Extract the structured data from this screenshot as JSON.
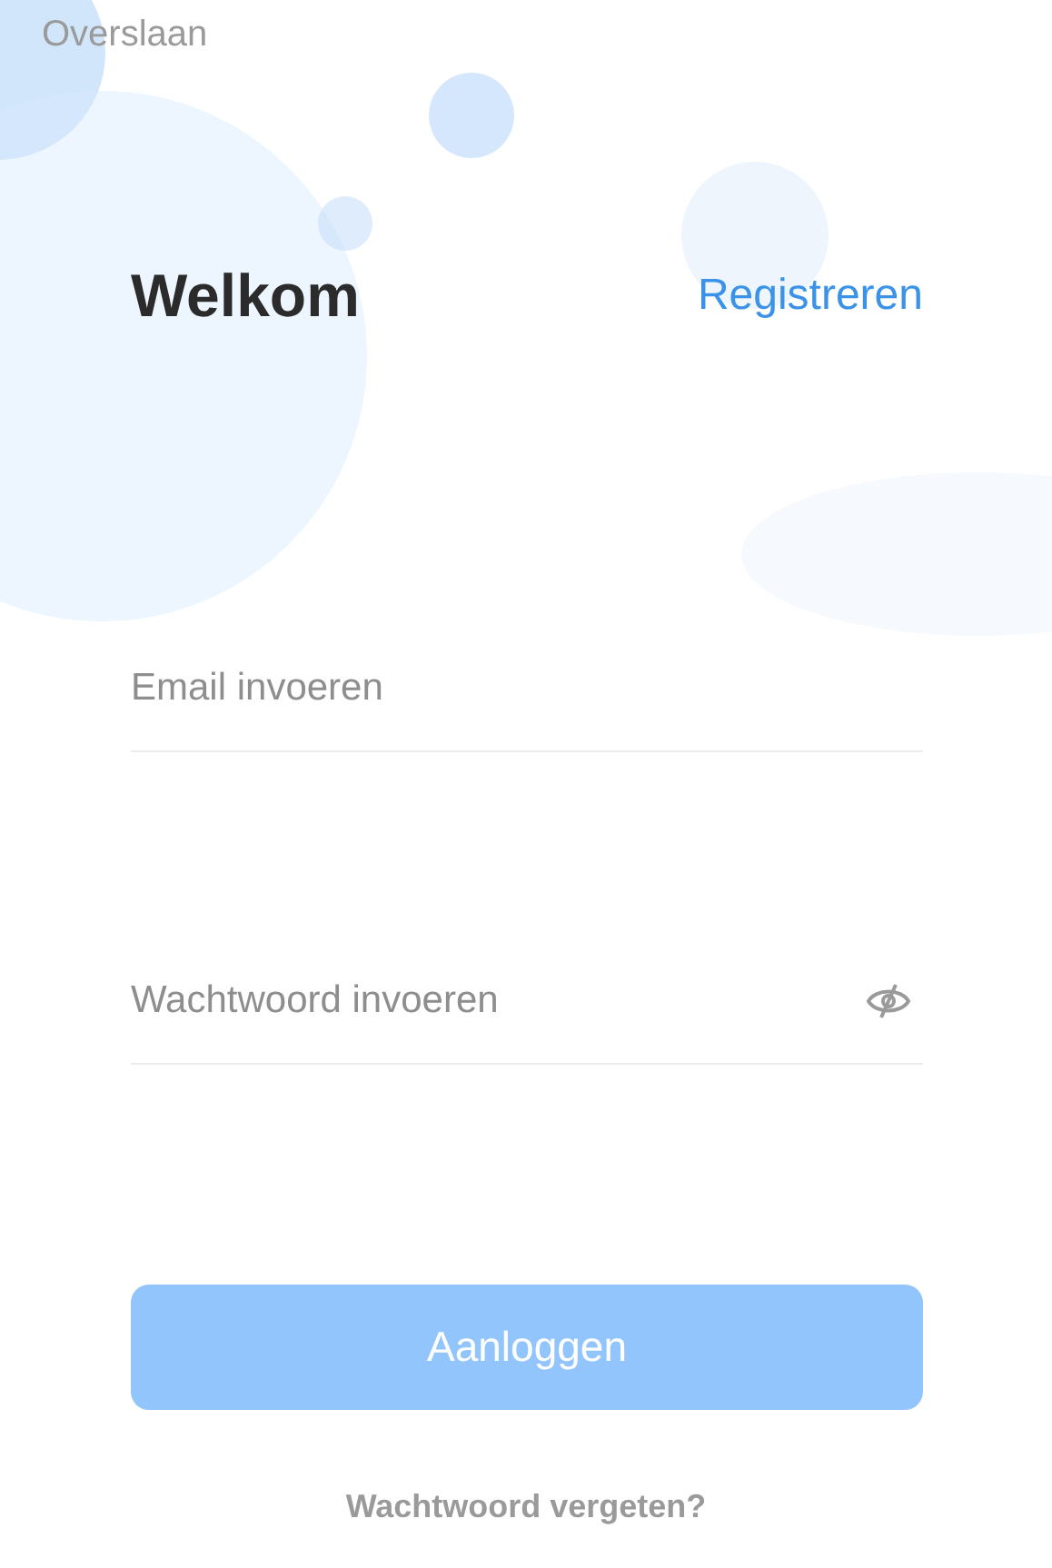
{
  "skip_link": "Overslaan",
  "title": "Welkom",
  "register_link": "Registreren",
  "email_field": {
    "placeholder": "Email invoeren"
  },
  "password_field": {
    "placeholder": "Wachtwoord invoeren",
    "password_visible": false
  },
  "login_button": {
    "label": "Aanloggen",
    "disabled": true
  },
  "forgot_link": "Wachtwoord vergeten?"
}
